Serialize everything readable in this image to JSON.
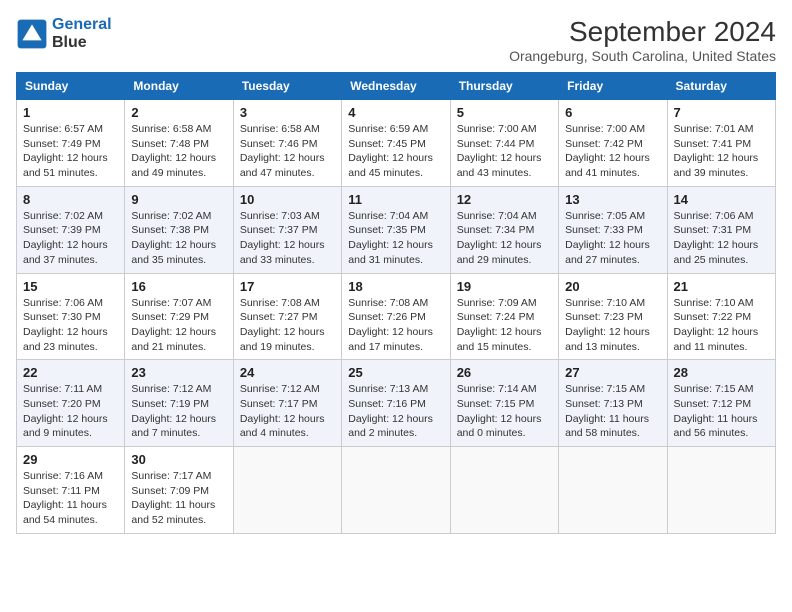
{
  "header": {
    "logo": {
      "line1": "General",
      "line2": "Blue"
    },
    "title": "September 2024",
    "subtitle": "Orangeburg, South Carolina, United States"
  },
  "weekdays": [
    "Sunday",
    "Monday",
    "Tuesday",
    "Wednesday",
    "Thursday",
    "Friday",
    "Saturday"
  ],
  "weeks": [
    [
      {
        "day": "1",
        "info": "Sunrise: 6:57 AM\nSunset: 7:49 PM\nDaylight: 12 hours\nand 51 minutes."
      },
      {
        "day": "2",
        "info": "Sunrise: 6:58 AM\nSunset: 7:48 PM\nDaylight: 12 hours\nand 49 minutes."
      },
      {
        "day": "3",
        "info": "Sunrise: 6:58 AM\nSunset: 7:46 PM\nDaylight: 12 hours\nand 47 minutes."
      },
      {
        "day": "4",
        "info": "Sunrise: 6:59 AM\nSunset: 7:45 PM\nDaylight: 12 hours\nand 45 minutes."
      },
      {
        "day": "5",
        "info": "Sunrise: 7:00 AM\nSunset: 7:44 PM\nDaylight: 12 hours\nand 43 minutes."
      },
      {
        "day": "6",
        "info": "Sunrise: 7:00 AM\nSunset: 7:42 PM\nDaylight: 12 hours\nand 41 minutes."
      },
      {
        "day": "7",
        "info": "Sunrise: 7:01 AM\nSunset: 7:41 PM\nDaylight: 12 hours\nand 39 minutes."
      }
    ],
    [
      {
        "day": "8",
        "info": "Sunrise: 7:02 AM\nSunset: 7:39 PM\nDaylight: 12 hours\nand 37 minutes."
      },
      {
        "day": "9",
        "info": "Sunrise: 7:02 AM\nSunset: 7:38 PM\nDaylight: 12 hours\nand 35 minutes."
      },
      {
        "day": "10",
        "info": "Sunrise: 7:03 AM\nSunset: 7:37 PM\nDaylight: 12 hours\nand 33 minutes."
      },
      {
        "day": "11",
        "info": "Sunrise: 7:04 AM\nSunset: 7:35 PM\nDaylight: 12 hours\nand 31 minutes."
      },
      {
        "day": "12",
        "info": "Sunrise: 7:04 AM\nSunset: 7:34 PM\nDaylight: 12 hours\nand 29 minutes."
      },
      {
        "day": "13",
        "info": "Sunrise: 7:05 AM\nSunset: 7:33 PM\nDaylight: 12 hours\nand 27 minutes."
      },
      {
        "day": "14",
        "info": "Sunrise: 7:06 AM\nSunset: 7:31 PM\nDaylight: 12 hours\nand 25 minutes."
      }
    ],
    [
      {
        "day": "15",
        "info": "Sunrise: 7:06 AM\nSunset: 7:30 PM\nDaylight: 12 hours\nand 23 minutes."
      },
      {
        "day": "16",
        "info": "Sunrise: 7:07 AM\nSunset: 7:29 PM\nDaylight: 12 hours\nand 21 minutes."
      },
      {
        "day": "17",
        "info": "Sunrise: 7:08 AM\nSunset: 7:27 PM\nDaylight: 12 hours\nand 19 minutes."
      },
      {
        "day": "18",
        "info": "Sunrise: 7:08 AM\nSunset: 7:26 PM\nDaylight: 12 hours\nand 17 minutes."
      },
      {
        "day": "19",
        "info": "Sunrise: 7:09 AM\nSunset: 7:24 PM\nDaylight: 12 hours\nand 15 minutes."
      },
      {
        "day": "20",
        "info": "Sunrise: 7:10 AM\nSunset: 7:23 PM\nDaylight: 12 hours\nand 13 minutes."
      },
      {
        "day": "21",
        "info": "Sunrise: 7:10 AM\nSunset: 7:22 PM\nDaylight: 12 hours\nand 11 minutes."
      }
    ],
    [
      {
        "day": "22",
        "info": "Sunrise: 7:11 AM\nSunset: 7:20 PM\nDaylight: 12 hours\nand 9 minutes."
      },
      {
        "day": "23",
        "info": "Sunrise: 7:12 AM\nSunset: 7:19 PM\nDaylight: 12 hours\nand 7 minutes."
      },
      {
        "day": "24",
        "info": "Sunrise: 7:12 AM\nSunset: 7:17 PM\nDaylight: 12 hours\nand 4 minutes."
      },
      {
        "day": "25",
        "info": "Sunrise: 7:13 AM\nSunset: 7:16 PM\nDaylight: 12 hours\nand 2 minutes."
      },
      {
        "day": "26",
        "info": "Sunrise: 7:14 AM\nSunset: 7:15 PM\nDaylight: 12 hours\nand 0 minutes."
      },
      {
        "day": "27",
        "info": "Sunrise: 7:15 AM\nSunset: 7:13 PM\nDaylight: 11 hours\nand 58 minutes."
      },
      {
        "day": "28",
        "info": "Sunrise: 7:15 AM\nSunset: 7:12 PM\nDaylight: 11 hours\nand 56 minutes."
      }
    ],
    [
      {
        "day": "29",
        "info": "Sunrise: 7:16 AM\nSunset: 7:11 PM\nDaylight: 11 hours\nand 54 minutes."
      },
      {
        "day": "30",
        "info": "Sunrise: 7:17 AM\nSunset: 7:09 PM\nDaylight: 11 hours\nand 52 minutes."
      },
      {
        "day": "",
        "info": ""
      },
      {
        "day": "",
        "info": ""
      },
      {
        "day": "",
        "info": ""
      },
      {
        "day": "",
        "info": ""
      },
      {
        "day": "",
        "info": ""
      }
    ]
  ]
}
